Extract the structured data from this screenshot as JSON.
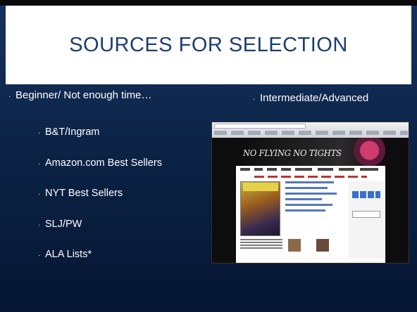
{
  "slide": {
    "title": "SOURCES FOR SELECTION",
    "bullet_glyph": "·",
    "left_heading": "Beginner/ Not enough time…",
    "right_heading": "Intermediate/Advanced",
    "sub_items": [
      "B&T/Ingram",
      "Amazon.com Best Sellers",
      "NYT Best Sellers",
      "SLJ/PW",
      "ALA Lists*"
    ]
  },
  "screenshot": {
    "banner_text": "NO FLYING NO TIGHTS"
  },
  "colors": {
    "background": "#0b2143",
    "title_text": "#1c3e6e",
    "title_box": "#ffffff",
    "body_text": "#ffffff"
  }
}
